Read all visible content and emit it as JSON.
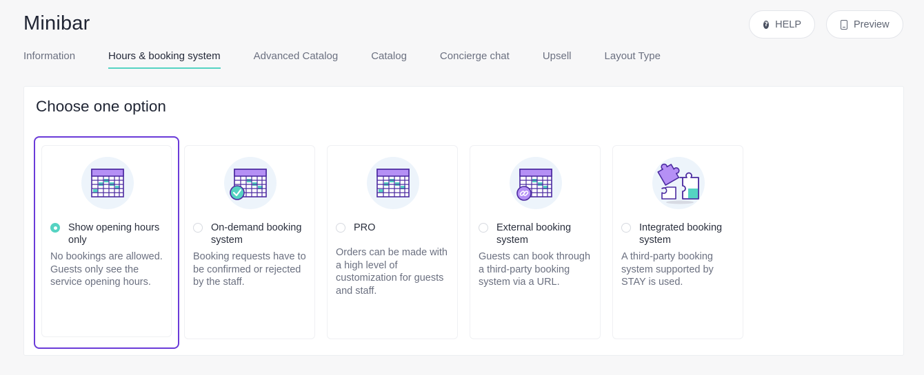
{
  "page": {
    "title": "Minibar"
  },
  "actions": {
    "help_label": "HELP",
    "help_icon": "?",
    "preview_label": "Preview"
  },
  "tabs": [
    {
      "label": "Information",
      "active": false
    },
    {
      "label": "Hours & booking system",
      "active": true
    },
    {
      "label": "Advanced Catalog",
      "active": false
    },
    {
      "label": "Catalog",
      "active": false
    },
    {
      "label": "Concierge chat",
      "active": false
    },
    {
      "label": "Upsell",
      "active": false
    },
    {
      "label": "Layout Type",
      "active": false
    }
  ],
  "panel": {
    "title": "Choose one option"
  },
  "options": [
    {
      "label": "Show opening hours only",
      "description": "No bookings are allowed. Guests only see the service opening hours.",
      "selected": true,
      "icon": "calendar-icon"
    },
    {
      "label": "On-demand booking system",
      "description": "Booking requests have to be confirmed or rejected by the staff.",
      "selected": false,
      "icon": "calendar-check-icon"
    },
    {
      "label": "PRO",
      "description": "Orders can be made with a high level of customization for guests and staff.",
      "selected": false,
      "icon": "calendar-icon"
    },
    {
      "label": "External booking system",
      "description": "Guests can book through a third-party booking system via a URL.",
      "selected": false,
      "icon": "calendar-link-icon"
    },
    {
      "label": "Integrated booking system",
      "description": "A third-party booking system supported by STAY is used.",
      "selected": false,
      "icon": "puzzle-icon"
    }
  ],
  "colors": {
    "accent_teal": "#55d3c2",
    "selected_border": "#6a3ad8",
    "calendar_header": "#b590f5",
    "calendar_outline": "#4b2aa0",
    "icon_background": "#edf4fb"
  }
}
